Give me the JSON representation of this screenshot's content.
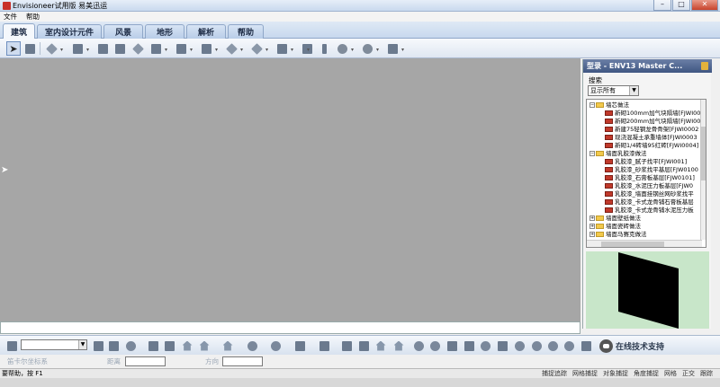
{
  "window": {
    "title": "Envisioneer试用版 易美迅运",
    "buttons": {
      "minimize": "–",
      "maximize": "□",
      "close": "✕"
    }
  },
  "menu": [
    {
      "label": "文件"
    },
    {
      "label": "帮助"
    }
  ],
  "tabs": [
    {
      "label": "建筑",
      "active": true
    },
    {
      "label": "室内设计元件"
    },
    {
      "label": "风景"
    },
    {
      "label": "地形"
    },
    {
      "label": "解析"
    },
    {
      "label": "帮助"
    }
  ],
  "catalog": {
    "title": "型录 - ENV13 Master C...",
    "search_label": "搜索",
    "filter_value": "显示所有",
    "tree": [
      {
        "level": 0,
        "type": "folder",
        "expanded": true,
        "label": "墙芯做法"
      },
      {
        "level": 1,
        "type": "item",
        "label": "新砌100mm加气块隔墙[FJWI00"
      },
      {
        "level": 1,
        "type": "item",
        "label": "新砌200mm加气块隔墙[FJWI00"
      },
      {
        "level": 1,
        "type": "item",
        "label": "新建75轻钢龙骨骨架[FJWI0002"
      },
      {
        "level": 1,
        "type": "item",
        "label": "现浇混凝土承重墙体[FJWI0003"
      },
      {
        "level": 1,
        "type": "item",
        "label": "新砌1/4砖墙95红砖[FJWI0004]"
      },
      {
        "level": 0,
        "type": "folder",
        "expanded": true,
        "label": "墙面乳胶漆做法"
      },
      {
        "level": 1,
        "type": "item",
        "label": "乳胶漆_腻子找平[FJWI001]"
      },
      {
        "level": 1,
        "type": "item",
        "label": "乳胶漆_砂浆找平基层[FJW0100"
      },
      {
        "level": 1,
        "type": "item",
        "label": "乳胶漆_石膏板基层[FJW0101]"
      },
      {
        "level": 1,
        "type": "item",
        "label": "乳胶漆_水泥压力板基层[FJW0"
      },
      {
        "level": 1,
        "type": "item",
        "label": "乳胶漆_墙面挂钢丝网砂浆找平"
      },
      {
        "level": 1,
        "type": "item",
        "label": "乳胶漆_卡式龙骨铺石膏板基层"
      },
      {
        "level": 1,
        "type": "item",
        "label": "乳胶漆_卡式龙骨铺水泥压力板"
      },
      {
        "level": 0,
        "type": "folder",
        "expanded": false,
        "label": "墙面壁纸做法"
      },
      {
        "level": 0,
        "type": "folder",
        "expanded": false,
        "label": "墙面瓷砖做法"
      },
      {
        "level": 0,
        "type": "folder",
        "expanded": false,
        "label": "墙面马赛克做法"
      }
    ]
  },
  "bottom_toolbar": {
    "support_text": "在线技术支持",
    "layer_value": ""
  },
  "coordinates": {
    "system_label": "笛卡尔坐标系",
    "distance_label": "距离",
    "direction_label": "方向",
    "distance_value": "",
    "direction_value": ""
  },
  "status": {
    "message": "要帮助，按 F1",
    "toggles": [
      "捕捉追踪",
      "网格捕捉",
      "对象捕捉",
      "角度捕捉",
      "网格",
      "正交",
      "跟踪"
    ]
  },
  "icons": {
    "tab_toolbar": [
      "select-arrow-icon",
      "brush-icon",
      "roof-icon",
      "stairs-icon",
      "window-icon",
      "window-grid-icon",
      "door-icon",
      "furniture-icon",
      "cabinet-icon",
      "fixture-icon",
      "roof-tool-icon",
      "floor-icon",
      "wall-icon",
      "column-icon",
      "ceiling-icon",
      "room-icon",
      "elevation-icon"
    ]
  }
}
